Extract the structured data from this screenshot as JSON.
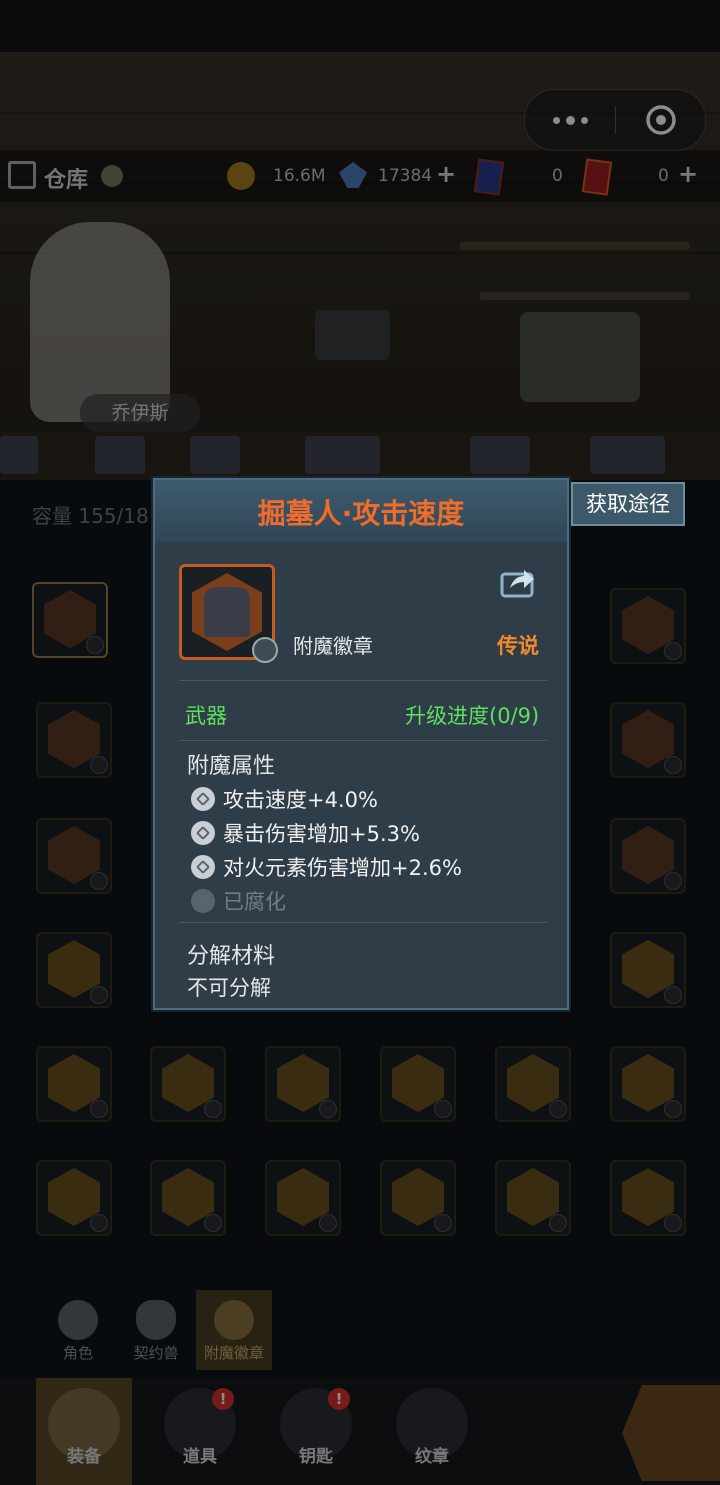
{
  "header": {
    "warehouse_title": "仓库",
    "gold": "16.6M",
    "gems": "17384",
    "card_blue_count": "0",
    "card_red_count": "0",
    "plus_symbol": "+"
  },
  "scene": {
    "hero_name": "乔伊斯"
  },
  "inventory": {
    "capacity_label": "容量",
    "capacity_value": "155/18"
  },
  "subtabs": [
    {
      "label": "角色",
      "icon": "character-icon"
    },
    {
      "label": "契约兽",
      "icon": "paw-icon"
    },
    {
      "label": "附魔徽章",
      "icon": "emblem-icon"
    }
  ],
  "bottom_nav": [
    {
      "label": "装备",
      "icon": "equipment-icon",
      "badge": ""
    },
    {
      "label": "道具",
      "icon": "chest-icon",
      "badge": "!"
    },
    {
      "label": "钥匙",
      "icon": "key-icon",
      "badge": "!"
    },
    {
      "label": "纹章",
      "icon": "crest-icon",
      "badge": ""
    }
  ],
  "dialog": {
    "title": "掘墓人·攻击速度",
    "obtain_button": "获取途径",
    "item_type": "附魔徽章",
    "rarity": "传说",
    "slot": "武器",
    "upgrade_progress": "升级进度(0/9)",
    "enchant_title": "附魔属性",
    "attributes": [
      "攻击速度+4.0%",
      "暴击伤害增加+5.3%",
      "对火元素伤害增加+2.6%",
      "已腐化"
    ],
    "material_title": "分解材料",
    "material_value": "不可分解"
  },
  "colors": {
    "rarity": "#f28a2a",
    "title": "#f06c2a",
    "green": "#5ee25e"
  }
}
